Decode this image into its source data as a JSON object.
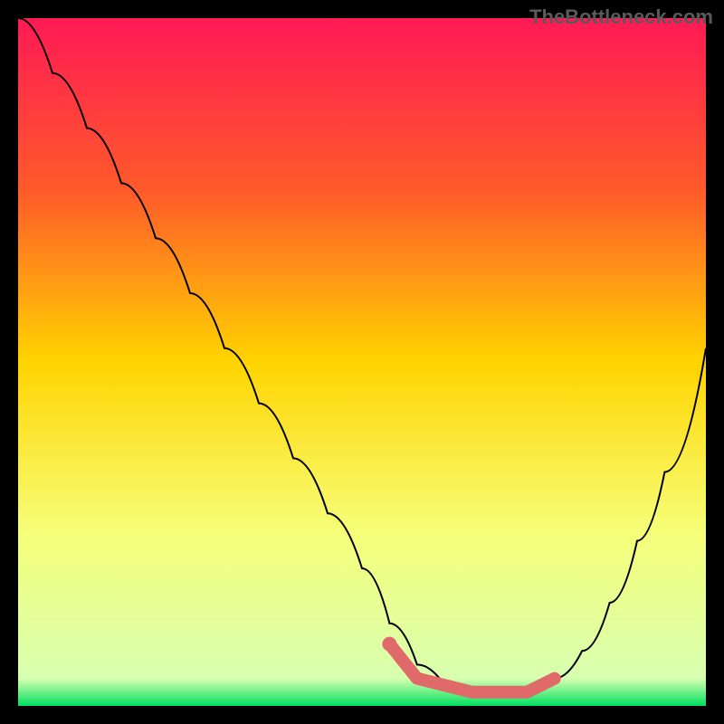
{
  "watermark": "TheBottleneck.com",
  "chart_data": {
    "type": "line",
    "title": "",
    "xlabel": "",
    "ylabel": "",
    "xlim": [
      0,
      100
    ],
    "ylim": [
      0,
      100
    ],
    "gradient_stops": [
      {
        "offset": 0,
        "color": "#ff1a55"
      },
      {
        "offset": 25,
        "color": "#ff5a2a"
      },
      {
        "offset": 50,
        "color": "#ffd400"
      },
      {
        "offset": 75,
        "color": "#f6ff7a"
      },
      {
        "offset": 96,
        "color": "#d8ffb0"
      },
      {
        "offset": 100,
        "color": "#00e060"
      }
    ],
    "series": [
      {
        "name": "curve",
        "color": "#000000",
        "x": [
          0,
          5,
          10,
          15,
          20,
          25,
          30,
          35,
          40,
          45,
          50,
          54,
          58,
          62,
          66,
          70,
          74,
          78,
          82,
          86,
          90,
          94,
          100
        ],
        "y": [
          100,
          92,
          84,
          76,
          68,
          60,
          52,
          44,
          36,
          28,
          20,
          12,
          6,
          3,
          2,
          2,
          2,
          4,
          8,
          15,
          24,
          34,
          52
        ]
      },
      {
        "name": "highlight",
        "color": "#e06a6a",
        "type": "scatter",
        "x": [
          54,
          58,
          62,
          66,
          70,
          74,
          78
        ],
        "y": [
          9,
          4,
          3,
          2,
          2,
          2,
          4
        ]
      }
    ]
  }
}
